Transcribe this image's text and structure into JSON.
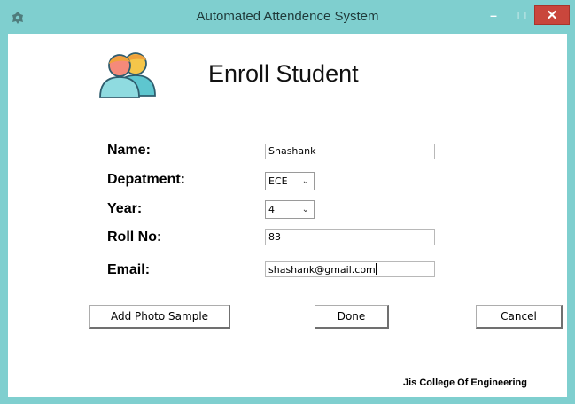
{
  "window": {
    "title": "Automated Attendence System",
    "controls": {
      "minimize": "–",
      "maximize": "□",
      "close": "✕"
    },
    "close_color": "#c9463c"
  },
  "icons": {
    "app": "app-icon",
    "header": "users-icon"
  },
  "form": {
    "heading": "Enroll Student",
    "name": {
      "label": "Name:",
      "value": "Shashank"
    },
    "department": {
      "label": "Depatment:",
      "value": "ECE"
    },
    "year": {
      "label": "Year:",
      "value": "4"
    },
    "roll_no": {
      "label": "Roll No:",
      "value": "83"
    },
    "email": {
      "label": "Email:",
      "value": "shashank@gmail.com"
    }
  },
  "buttons": {
    "add_photo": "Add Photo Sample",
    "done": "Done",
    "cancel": "Cancel"
  },
  "footer": {
    "text": "Jis College Of Engineering"
  },
  "colors": {
    "frame": "#7fcfcf",
    "client": "#ffffff"
  }
}
